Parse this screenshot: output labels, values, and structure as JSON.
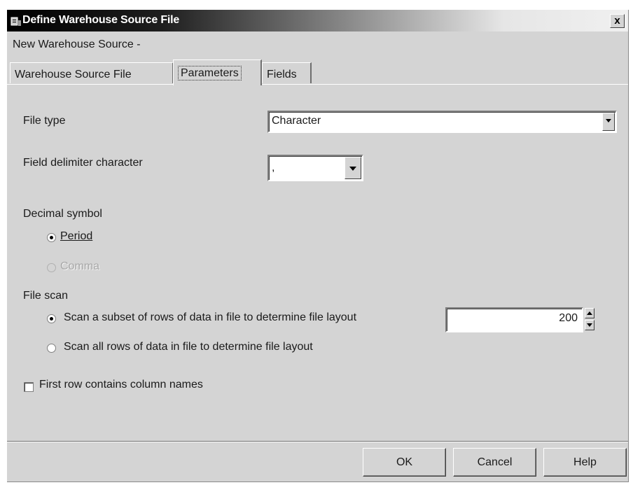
{
  "window": {
    "title": "Define Warehouse Source File",
    "close_label": "x",
    "subtitle": "New Warehouse Source -"
  },
  "tabs": [
    {
      "label": "Warehouse Source File",
      "active": false
    },
    {
      "label": "Parameters",
      "active": true
    },
    {
      "label": "Fields",
      "active": false
    }
  ],
  "parameters": {
    "file_type": {
      "label": "File type",
      "value": "Character"
    },
    "field_delimiter": {
      "label": "Field delimiter character",
      "value": ","
    },
    "decimal_symbol": {
      "label": "Decimal symbol",
      "options": [
        {
          "label": "Period",
          "selected": true,
          "enabled": true
        },
        {
          "label": "Comma",
          "selected": false,
          "enabled": false
        }
      ]
    },
    "file_scan": {
      "label": "File scan",
      "options": [
        {
          "label": "Scan a subset of rows of data in file to determine file layout",
          "selected": true
        },
        {
          "label": "Scan all rows of data in file to determine file layout",
          "selected": false
        }
      ],
      "row_count": "200"
    },
    "first_row_header": {
      "label": "First row contains column names",
      "checked": false
    }
  },
  "buttons": {
    "ok": "OK",
    "cancel": "Cancel",
    "help": "Help"
  },
  "colors": {
    "dialog_bg": "#d4d4d4",
    "title_gradient_start": "#000000",
    "title_gradient_end": "#f0f0f0"
  },
  "icons": [
    "app-icon",
    "close-icon",
    "chevron-down-icon",
    "spin-up-icon",
    "spin-down-icon"
  ]
}
